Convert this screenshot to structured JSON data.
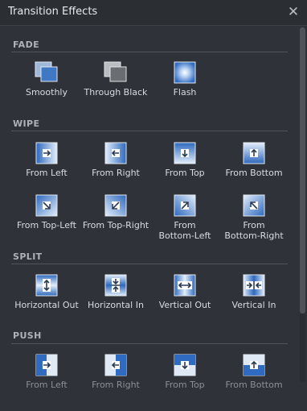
{
  "window": {
    "title": "Transition Effects",
    "close_icon": "close-icon"
  },
  "sections": {
    "fade": {
      "title": "FADE",
      "items": [
        {
          "label": "Smoothly",
          "icon": "fade-smoothly-icon"
        },
        {
          "label": "Through Black",
          "icon": "fade-through-black-icon"
        },
        {
          "label": "Flash",
          "icon": "fade-flash-icon"
        }
      ]
    },
    "wipe": {
      "title": "WIPE",
      "items": [
        {
          "label": "From Left",
          "icon": "arrow-right-icon"
        },
        {
          "label": "From Right",
          "icon": "arrow-left-icon"
        },
        {
          "label": "From Top",
          "icon": "arrow-down-icon"
        },
        {
          "label": "From Bottom",
          "icon": "arrow-up-icon"
        },
        {
          "label": "From Top-Left",
          "icon": "arrow-down-right-icon"
        },
        {
          "label": "From Top-Right",
          "icon": "arrow-down-left-icon"
        },
        {
          "label": "From Bottom-Left",
          "label_lines": [
            "From",
            "Bottom-Left"
          ],
          "icon": "arrow-up-right-icon"
        },
        {
          "label": "From Bottom-Right",
          "label_lines": [
            "From",
            "Bottom-Right"
          ],
          "icon": "arrow-up-left-icon"
        }
      ]
    },
    "split": {
      "title": "SPLIT",
      "items": [
        {
          "label": "Horizontal Out",
          "icon": "split-horizontal-out-icon"
        },
        {
          "label": "Horizontal In",
          "icon": "split-horizontal-in-icon"
        },
        {
          "label": "Vertical Out",
          "icon": "split-vertical-out-icon"
        },
        {
          "label": "Vertical In",
          "icon": "split-vertical-in-icon"
        }
      ]
    },
    "push": {
      "title": "PUSH",
      "items": [
        {
          "label": "From Left",
          "icon": "push-from-left-icon"
        },
        {
          "label": "From Right",
          "icon": "push-from-right-icon"
        },
        {
          "label": "From Top",
          "icon": "push-from-top-icon"
        },
        {
          "label": "From Bottom",
          "icon": "push-from-bottom-icon"
        }
      ]
    }
  },
  "colors": {
    "background": "#2f3238",
    "icon_blue": "#3a78c8",
    "icon_light": "#dce9f8",
    "section_title": "#aeb3ba"
  }
}
